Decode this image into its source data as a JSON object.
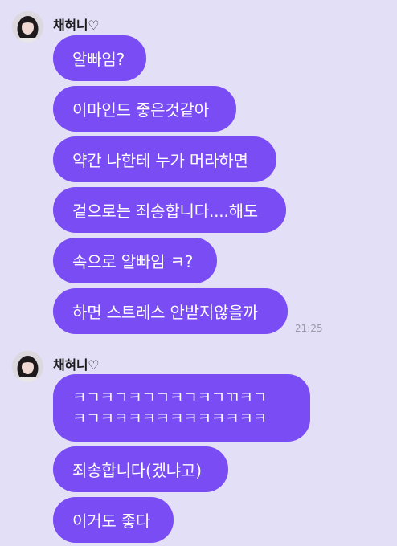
{
  "groups": [
    {
      "sender": "채혀니♡",
      "messages": [
        "알빠임?",
        "이마인드 좋은것같아",
        "약간 나한테 누가 머라하면",
        "겉으로는 죄송합니다....해도",
        "속으로 알빠임 ㅋ?",
        "하면 스트레스 안받지않을까"
      ],
      "time": "21:25"
    },
    {
      "sender": "채혀니♡",
      "multiline_message": [
        "ㅋㄱㅋㄱㅋㄱㄱㅋㄱㅋㄱㄲㅋㄱ",
        "ㅋㄱㅋㅋㅋㅋㅋㅋㅋㅋㅋㅋㅋㅋ"
      ],
      "messages": [
        "죄송합니다(겠냐고)",
        "이거도 좋다"
      ]
    }
  ],
  "colors": {
    "background": "#e3dff6",
    "bubble": "#7a4cf4",
    "bubble_text": "#ffffff",
    "time_text": "#9a97a8"
  },
  "icons": {
    "avatar": "profile-photo"
  }
}
